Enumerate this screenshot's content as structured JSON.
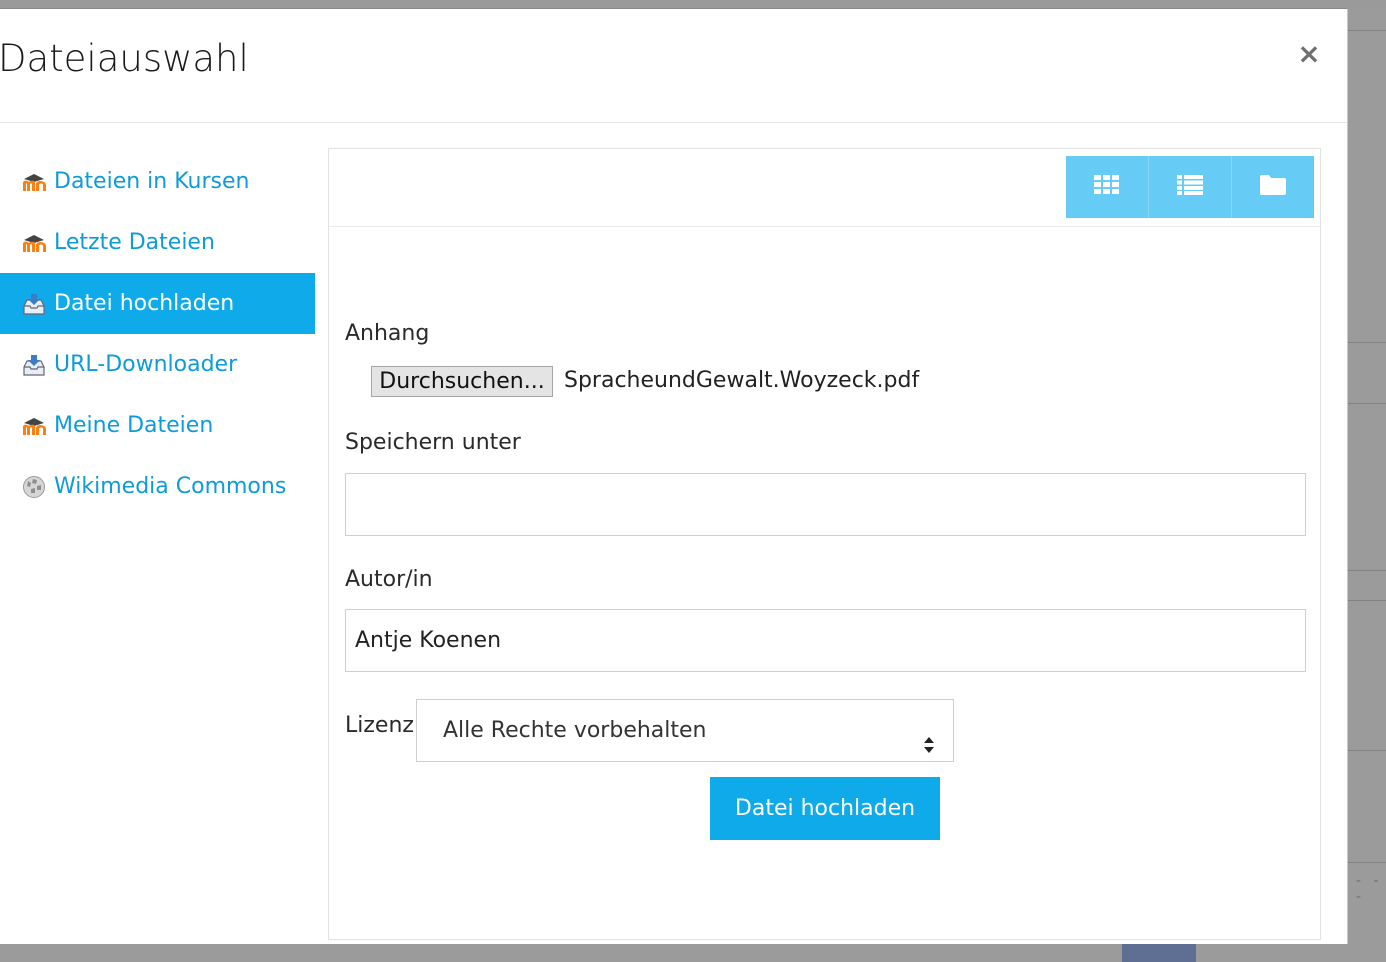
{
  "dialog": {
    "title": "Dateiauswahl",
    "close_symbol": "×"
  },
  "sidebar": {
    "items": [
      {
        "label": "Dateien in Kursen",
        "icon": "moodle-icon",
        "active": false
      },
      {
        "label": "Letzte Dateien",
        "icon": "moodle-icon",
        "active": false
      },
      {
        "label": "Datei hochladen",
        "icon": "upload-icon",
        "active": true
      },
      {
        "label": "URL-Downloader",
        "icon": "download-icon",
        "active": false
      },
      {
        "label": "Meine Dateien",
        "icon": "moodle-icon",
        "active": false
      },
      {
        "label": "Wikimedia Commons",
        "icon": "wikimedia-icon",
        "active": false
      }
    ]
  },
  "toolbar": {
    "views": [
      "grid-view-icon",
      "list-view-icon",
      "folder-view-icon"
    ],
    "accent": "#66ccf5"
  },
  "form": {
    "attachment_label": "Anhang",
    "browse_label": "Durchsuchen...",
    "selected_file": "SpracheundGewalt.Woyzeck.pdf",
    "save_as_label": "Speichern unter",
    "save_as_value": "",
    "author_label": "Autor/in",
    "author_value": "Antje Koenen",
    "license_label": "Lizenz",
    "license_value": "Alle Rechte vorbehalten",
    "submit_label": "Datei hochladen"
  },
  "colors": {
    "primary": "#0faaea",
    "link": "#0f9bd7"
  },
  "background": {
    "dash_text": "- - -"
  }
}
